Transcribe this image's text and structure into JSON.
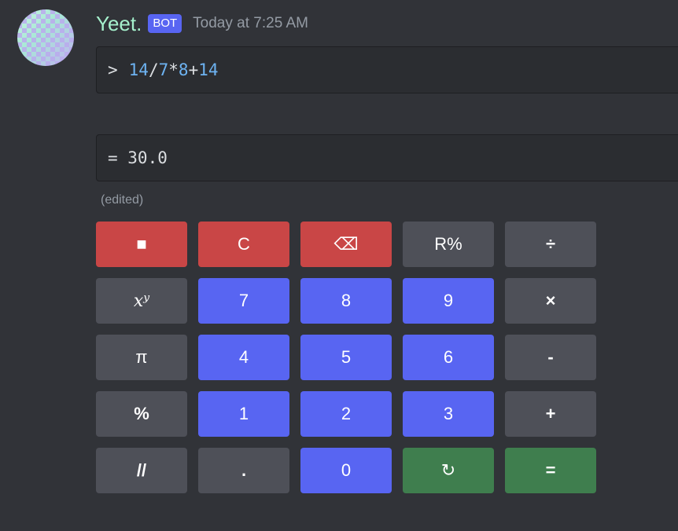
{
  "message": {
    "author": "Yeet.",
    "badge": "BOT",
    "timestamp": "Today at 7:25 AM",
    "edited": "(edited)"
  },
  "input_block": {
    "prompt": ">",
    "tokens": [
      "14",
      "/",
      "7",
      "*",
      "8",
      "+",
      "14"
    ]
  },
  "output_block": {
    "text": "= 30.0"
  },
  "colors": {
    "username": "#a5f0cc",
    "badge": "#5865f2",
    "red_button": "#c94646",
    "grey_button": "#4e5058",
    "blue_button": "#5865f2",
    "green_button": "#3f7e4e",
    "number_token": "#6db3f2"
  },
  "keypad": [
    {
      "label": "■",
      "style": "red",
      "name": "stop-button"
    },
    {
      "label": "C",
      "style": "red",
      "name": "clear-button"
    },
    {
      "label": "⌫",
      "style": "red",
      "name": "backspace-button"
    },
    {
      "label": "R%",
      "style": "grey",
      "name": "reverse-percent-button"
    },
    {
      "label": "÷",
      "style": "grey",
      "name": "divide-button"
    },
    {
      "label": "𝑥ʸ",
      "style": "grey",
      "name": "power-button"
    },
    {
      "label": "7",
      "style": "blue",
      "name": "digit-7-button"
    },
    {
      "label": "8",
      "style": "blue",
      "name": "digit-8-button"
    },
    {
      "label": "9",
      "style": "blue",
      "name": "digit-9-button"
    },
    {
      "label": "×",
      "style": "grey",
      "name": "multiply-button"
    },
    {
      "label": "π",
      "style": "grey",
      "name": "pi-button"
    },
    {
      "label": "4",
      "style": "blue",
      "name": "digit-4-button"
    },
    {
      "label": "5",
      "style": "blue",
      "name": "digit-5-button"
    },
    {
      "label": "6",
      "style": "blue",
      "name": "digit-6-button"
    },
    {
      "label": "-",
      "style": "grey",
      "name": "subtract-button"
    },
    {
      "label": "%",
      "style": "grey",
      "name": "percent-button"
    },
    {
      "label": "1",
      "style": "blue",
      "name": "digit-1-button"
    },
    {
      "label": "2",
      "style": "blue",
      "name": "digit-2-button"
    },
    {
      "label": "3",
      "style": "blue",
      "name": "digit-3-button"
    },
    {
      "label": "+",
      "style": "grey",
      "name": "add-button"
    },
    {
      "label": "//",
      "style": "grey",
      "name": "floor-divide-button"
    },
    {
      "label": ".",
      "style": "grey",
      "name": "decimal-point-button"
    },
    {
      "label": "0",
      "style": "blue",
      "name": "digit-0-button"
    },
    {
      "label": "↻",
      "style": "green",
      "name": "refresh-button"
    },
    {
      "label": "=",
      "style": "green",
      "name": "equals-button"
    }
  ]
}
